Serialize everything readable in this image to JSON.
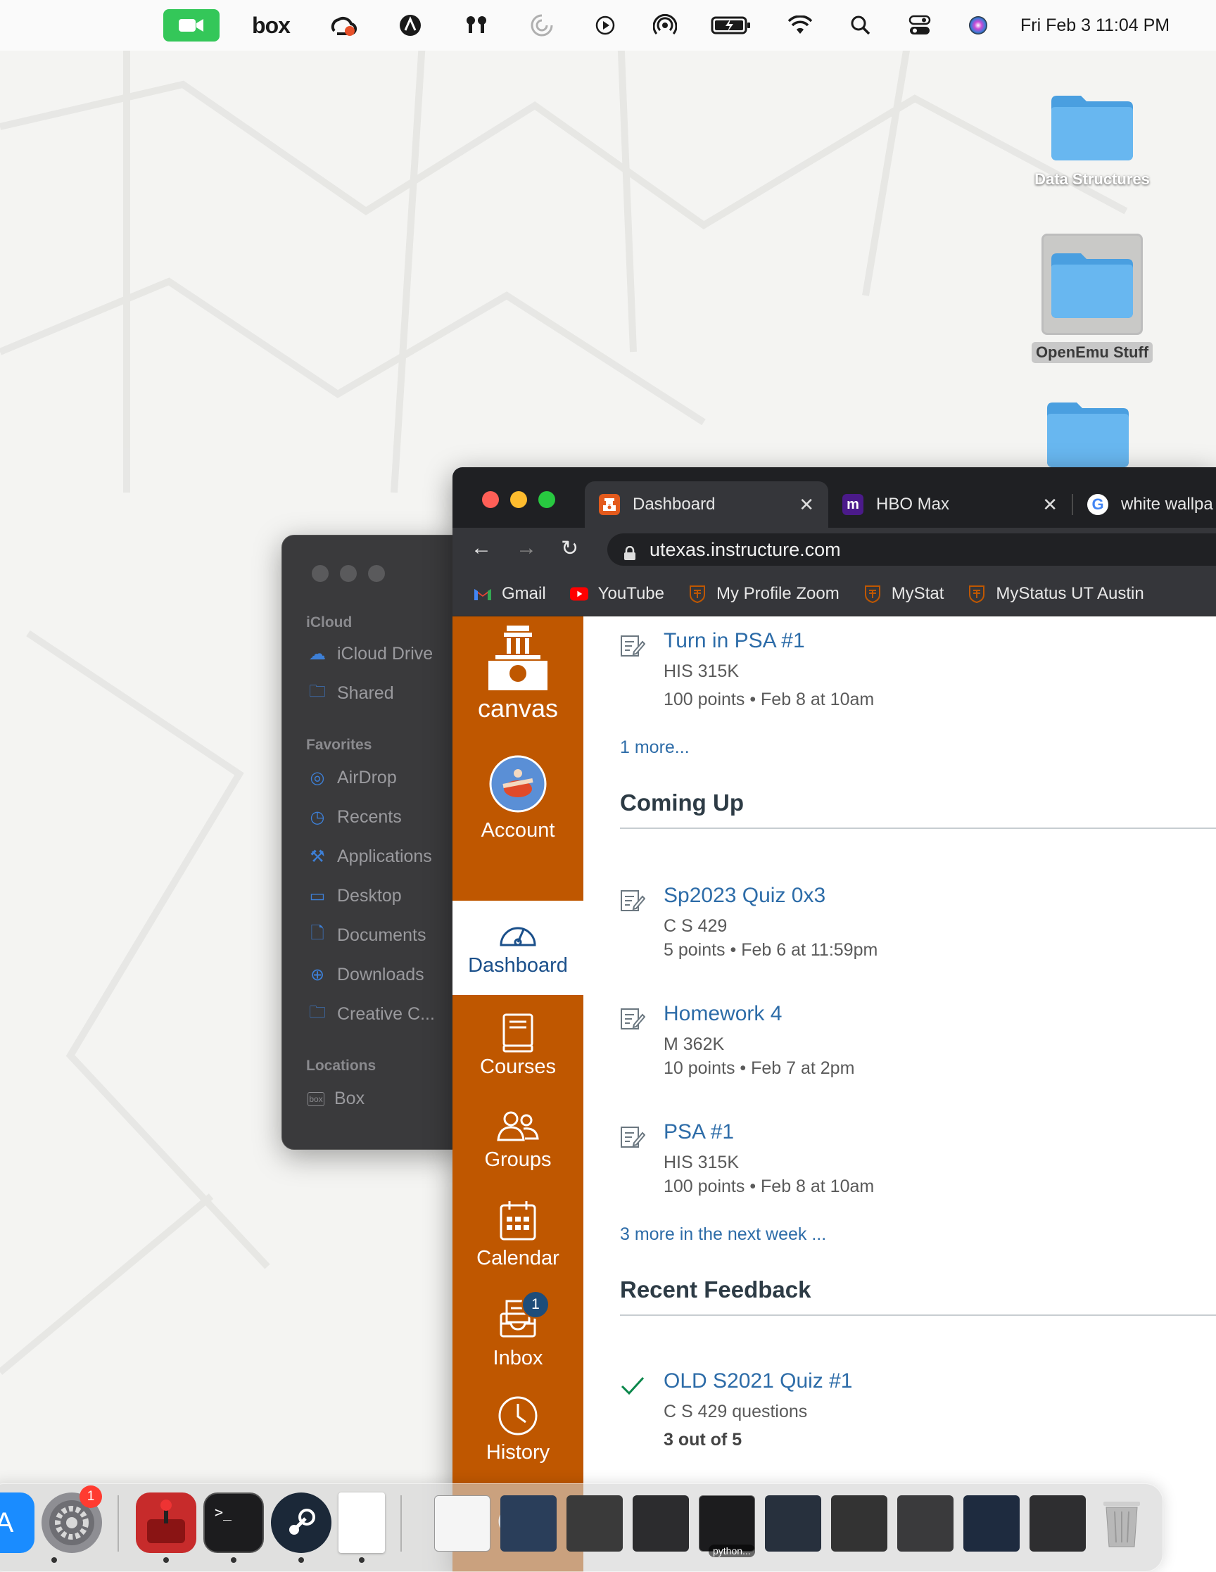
{
  "menubar": {
    "box_label": "box",
    "datetime": "Fri Feb 3  11:04 PM",
    "icons": [
      "facetime-icon",
      "box-icon",
      "creative-cloud-icon",
      "vpn-icon",
      "airpods-icon",
      "loading-icon",
      "play-icon",
      "airdrop-icon",
      "battery-icon",
      "wifi-icon",
      "search-icon",
      "control-center-icon",
      "siri-icon"
    ]
  },
  "desktop": {
    "icons": [
      {
        "label": "Data Structures"
      },
      {
        "label": "OpenEmu Stuff"
      }
    ]
  },
  "finder": {
    "sections": {
      "icloud": "iCloud",
      "favorites": "Favorites",
      "locations": "Locations"
    },
    "icloud_items": [
      "iCloud Drive",
      "Shared"
    ],
    "favorite_items": [
      "AirDrop",
      "Recents",
      "Applications",
      "Desktop",
      "Documents",
      "Downloads",
      "Creative C..."
    ],
    "location_items": [
      "Box"
    ],
    "accent": "#3d7fd6"
  },
  "browser": {
    "tabs": [
      {
        "label": "Dashboard",
        "active": true
      },
      {
        "label": "HBO Max",
        "active": false
      },
      {
        "label": "white wallpa",
        "active": false
      }
    ],
    "url": "utexas.instructure.com",
    "bookmarks": [
      {
        "label": "Gmail",
        "icon": "gmail-icon"
      },
      {
        "label": "YouTube",
        "icon": "youtube-icon"
      },
      {
        "label": "My Profile Zoom",
        "icon": "ut-shield-icon"
      },
      {
        "label": "MyStat",
        "icon": "ut-shield-icon"
      },
      {
        "label": "MyStatus UT Austin",
        "icon": "ut-shield-icon"
      }
    ]
  },
  "canvas": {
    "brand_color": "#bf5700",
    "logo_text": "canvas",
    "nav": {
      "account": "Account",
      "dashboard": "Dashboard",
      "courses": "Courses",
      "groups": "Groups",
      "calendar": "Calendar",
      "inbox": "Inbox",
      "inbox_badge": "1",
      "history": "History"
    },
    "todo": {
      "title": "Turn in PSA #1",
      "course": "HIS 315K",
      "meta": "100 points • Feb 8 at 10am",
      "more": "1 more..."
    },
    "coming_up": {
      "heading": "Coming Up",
      "items": [
        {
          "title": "Sp2023 Quiz 0x3",
          "course": "C S 429",
          "meta": "5 points • Feb 6 at 11:59pm"
        },
        {
          "title": "Homework 4",
          "course": "M 362K",
          "meta": "10 points • Feb 7 at 2pm"
        },
        {
          "title": "PSA #1",
          "course": "HIS 315K",
          "meta": "100 points • Feb 8 at 10am"
        }
      ],
      "more": "3 more in the next week ..."
    },
    "recent_feedback": {
      "heading": "Recent Feedback",
      "item": {
        "title": "OLD S2021 Quiz #1",
        "course": "C S 429 questions",
        "score": "3 out of 5"
      }
    }
  },
  "dock": {
    "settings_badge": "1",
    "python_caption": "python..."
  }
}
